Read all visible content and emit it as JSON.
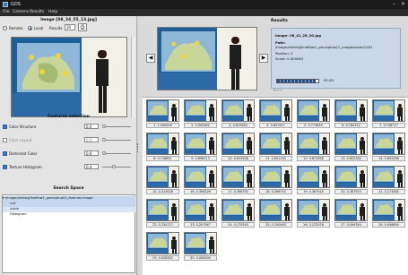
{
  "window": {
    "title": "GOS"
  },
  "menu": [
    "File",
    "Camera",
    "Results",
    "Help"
  ],
  "image_panel": {
    "title": "Image [08_34_55_13.jpg]",
    "source_remote": "Remote",
    "source_local": "Local",
    "results_label": "Results",
    "results_value": "30"
  },
  "features": {
    "title": "Features selection",
    "items": [
      {
        "label": "Color Structure",
        "value": "0.0",
        "checked": true
      },
      {
        "label": "Color Layout",
        "value": "0.0",
        "checked": false
      },
      {
        "label": "Dominant Color",
        "value": "0.0",
        "checked": true
      },
      {
        "label": "Texture Histogram",
        "value": "0.4",
        "checked": true
      }
    ]
  },
  "search_space": {
    "title": "Search Space",
    "rows": [
      "/Image/aheisig/lineflow1_perceptual/3_features-image",
      "ccd",
      "uvem",
      "Histogram"
    ]
  },
  "results": {
    "title": "Results",
    "info": {
      "image": "Image: 08_41_28_20.jpg",
      "path_label": "Path:",
      "path_value": "/image/aheisig/lineflow1_perceptual/1_image/score/1281",
      "position": "Position: 2",
      "score": "Score: 0.000563",
      "percent": "93.4%",
      "progress": 0.934
    }
  },
  "thumbnails": [
    {
      "caption": "1. 1.000000"
    },
    {
      "caption": "2. 0.900562"
    },
    {
      "caption": "3. 0.815584"
    },
    {
      "caption": "4. 0.801957"
    },
    {
      "caption": "5. 0.773835"
    },
    {
      "caption": "6. 0.764152"
    },
    {
      "caption": "7. 0.756717"
    },
    {
      "caption": "8. 0.716891"
    },
    {
      "caption": "9. 0.698113"
    },
    {
      "caption": "10. 0.615208"
    },
    {
      "caption": "11. 0.651150"
    },
    {
      "caption": "12. 0.671658"
    },
    {
      "caption": "13. 0.652284"
    },
    {
      "caption": "14. 0.652096"
    },
    {
      "caption": "15. 0.414528"
    },
    {
      "caption": "16. 0.396226"
    },
    {
      "caption": "17. 0.396792"
    },
    {
      "caption": "18. 0.396792"
    },
    {
      "caption": "19. 0.367925"
    },
    {
      "caption": "20. 0.367925"
    },
    {
      "caption": "21. 0.273585"
    },
    {
      "caption": "22. 0.254717"
    },
    {
      "caption": "23. 0.207547"
    },
    {
      "caption": "24. 0.179245"
    },
    {
      "caption": "25. 0.150943"
    },
    {
      "caption": "26. 0.122076"
    },
    {
      "caption": "27. 0.094340"
    },
    {
      "caption": "28. 0.056604"
    },
    {
      "caption": "29. 0.028302"
    },
    {
      "caption": "30. 0.000000"
    }
  ]
}
